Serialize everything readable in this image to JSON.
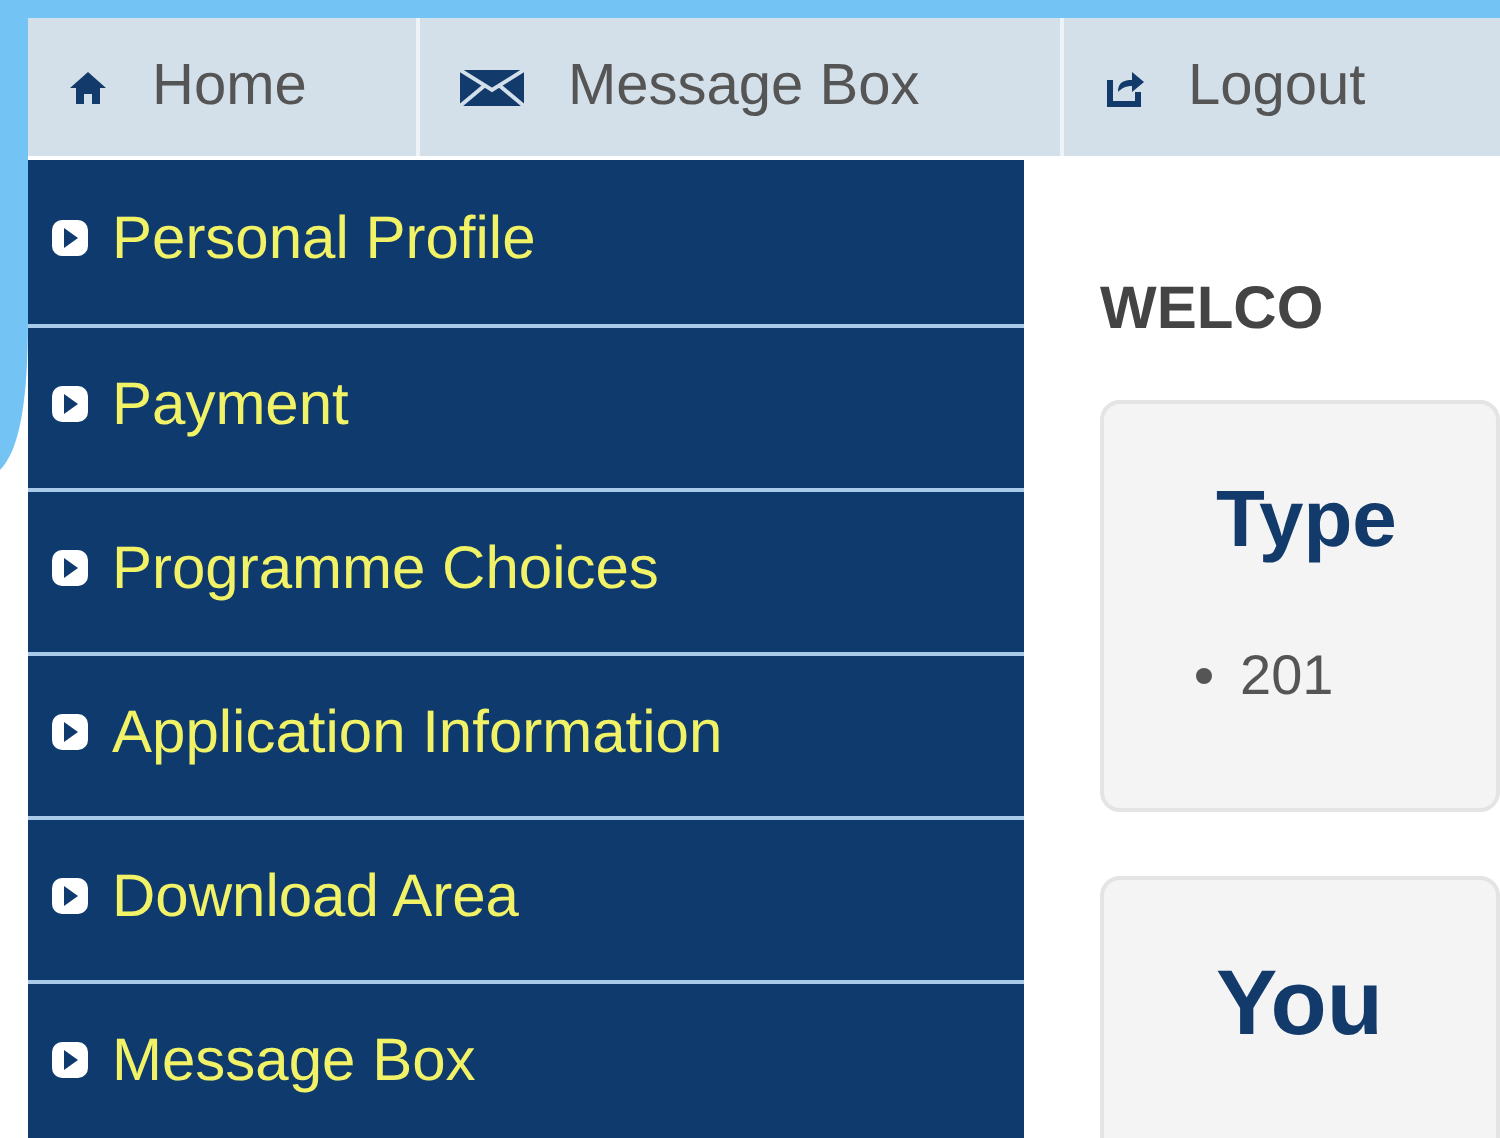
{
  "topnav": [
    {
      "kind": "home",
      "label": "Home"
    },
    {
      "kind": "mail",
      "label": "Message Box"
    },
    {
      "kind": "logout",
      "label": "Logout"
    }
  ],
  "sidebar": {
    "items": [
      {
        "label": "Personal Profile"
      },
      {
        "label": "Payment"
      },
      {
        "label": "Programme Choices"
      },
      {
        "label": "Application Information"
      },
      {
        "label": "Download Area"
      },
      {
        "label": "Message Box"
      }
    ]
  },
  "main": {
    "heading": "WELCO",
    "cards": [
      {
        "title": "Type",
        "bullets": [
          "201"
        ]
      },
      {
        "title": "You"
      }
    ]
  }
}
